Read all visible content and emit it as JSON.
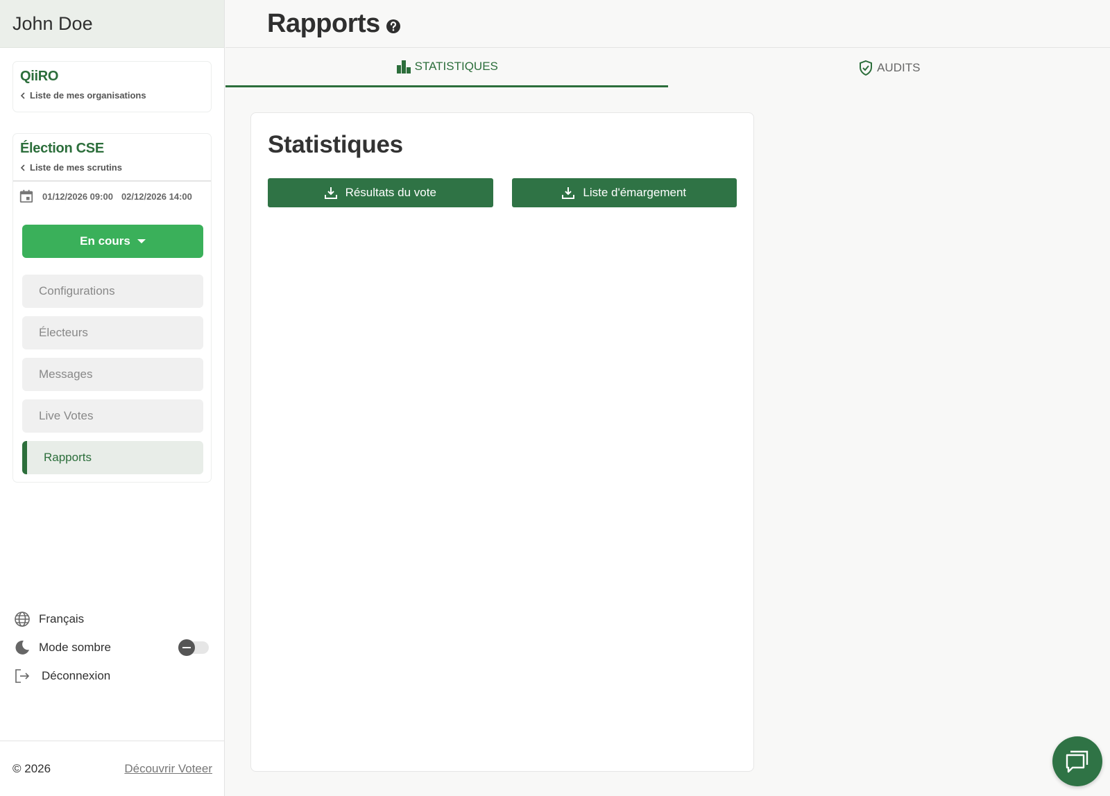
{
  "user": {
    "name": "John Doe"
  },
  "organization": {
    "name": "QiiRO",
    "back_label": "Liste de mes organisations"
  },
  "election": {
    "name": "Élection CSE",
    "back_label": "Liste de mes scrutins",
    "start": "01/12/2026 09:00",
    "end": "02/12/2026 14:00",
    "status_label": "En cours"
  },
  "menu": {
    "items": [
      {
        "label": "Configurations"
      },
      {
        "label": "Électeurs"
      },
      {
        "label": "Messages"
      },
      {
        "label": "Live Votes"
      },
      {
        "label": "Rapports"
      }
    ],
    "active_index": 4
  },
  "settings": {
    "language": "Français",
    "dark_mode_label": "Mode sombre",
    "dark_mode_on": false,
    "logout": "Déconnexion"
  },
  "footer": {
    "copyright": "© 2026",
    "link": "Découvrir Voteer"
  },
  "page": {
    "title": "Rapports"
  },
  "tabs": [
    {
      "label": "STATISTIQUES",
      "icon": "bar-chart-icon",
      "active": true
    },
    {
      "label": "AUDITS",
      "icon": "shield-check-icon",
      "active": false
    }
  ],
  "panel": {
    "title": "Statistiques",
    "buttons": [
      {
        "label": "Résultats du vote",
        "icon": "download-icon"
      },
      {
        "label": "Liste d'émargement",
        "icon": "download-icon"
      }
    ]
  },
  "colors": {
    "primary": "#2f7345",
    "accent_green": "#3ab05a",
    "brand_text": "#2c6e3b"
  }
}
